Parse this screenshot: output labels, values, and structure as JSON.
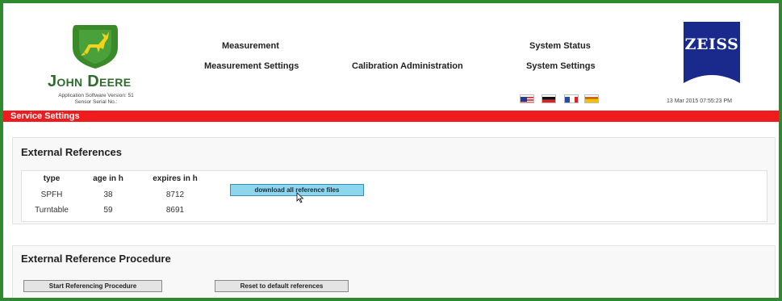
{
  "brand": {
    "company_name": "John Deere",
    "partner_logo_text": "ZEISS",
    "app_version": "Application Software Version: 51",
    "sensor_serial": "Sensor Serial No.:"
  },
  "nav": {
    "measurement": "Measurement",
    "measurement_settings": "Measurement Settings",
    "calibration_administration": "Calibration Administration",
    "system_status": "System Status",
    "system_settings": "System Settings"
  },
  "languages": [
    "us-flag-icon",
    "german-flag-icon",
    "french-flag-icon",
    "spanish-flag-icon"
  ],
  "datetime": "13 Mar 2015 07:55:23 PM",
  "page_title": "Service Settings",
  "external_references": {
    "title": "External References",
    "columns": [
      "type",
      "age in h",
      "expires in h"
    ],
    "rows": [
      {
        "type": "SPFH",
        "age": "38",
        "expires": "8712"
      },
      {
        "type": "Turntable",
        "age": "59",
        "expires": "8691"
      }
    ],
    "download_button": "download all reference files"
  },
  "procedure": {
    "title": "External Reference Procedure",
    "start_button": "Start Referencing Procedure",
    "reset_button": "Reset to default references"
  },
  "colors": {
    "frame_green": "#2f8a2f",
    "service_bar_red": "#ee1c1c",
    "zeiss_blue": "#1a2a8c",
    "download_button": "#8dd7ee"
  }
}
